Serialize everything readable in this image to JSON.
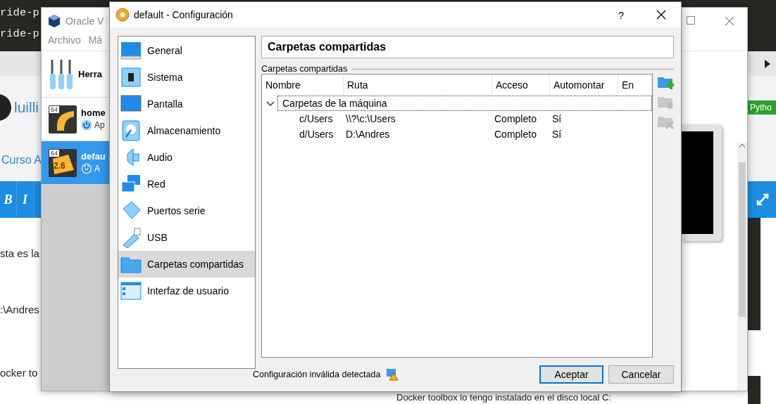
{
  "background_page": {
    "code_lines": [
      "ride-p",
      "ride-p"
    ],
    "user_name": "luilli",
    "course_link": "Curso A",
    "editor_toolbar": [
      {
        "label": "B"
      },
      {
        "label": "I"
      }
    ],
    "body_lines": [
      "sta es la",
      ":\\Andres",
      "ocker to"
    ],
    "tag": "Pytho",
    "footer_text": "Docker toolbox lo tengo instalado en el disco local C:"
  },
  "manager_window": {
    "title": "Oracle V",
    "menu": [
      "Archivo",
      "Má"
    ],
    "machines": [
      {
        "kind": "tools",
        "name": "Herra",
        "selected": false
      },
      {
        "kind": "vm",
        "name": "home",
        "arch": "64",
        "state": "Ap",
        "selected": false
      },
      {
        "kind": "vm",
        "name": "defau",
        "arch": "64",
        "badge": "2.6",
        "state": "A",
        "selected": true
      }
    ]
  },
  "dialog": {
    "title": "default - Configuración",
    "help": "?",
    "sections": [
      {
        "kind": "general",
        "label": "General",
        "selected": false
      },
      {
        "kind": "system",
        "label": "Sistema",
        "selected": false
      },
      {
        "kind": "display",
        "label": "Pantalla",
        "selected": false
      },
      {
        "kind": "storage",
        "label": "Almacenamiento",
        "selected": false
      },
      {
        "kind": "audio",
        "label": "Audio",
        "selected": false
      },
      {
        "kind": "network",
        "label": "Red",
        "selected": false
      },
      {
        "kind": "serial",
        "label": "Puertos serie",
        "selected": false
      },
      {
        "kind": "usb",
        "label": "USB",
        "selected": false
      },
      {
        "kind": "shared",
        "label": "Carpetas compartidas",
        "selected": true
      },
      {
        "kind": "ui",
        "label": "Interfaz de usuario",
        "selected": false
      }
    ],
    "page_title": "Carpetas compartidas",
    "group_label": "Carpetas compartidas",
    "table": {
      "columns": [
        "Nombre",
        "Ruta",
        "Acceso",
        "Automontar",
        "En"
      ],
      "groups": [
        {
          "label": "Carpetas de la máquina",
          "expanded": true,
          "rows": [
            {
              "name": "c/Users",
              "path": "\\\\?\\c:\\Users",
              "access": "Completo",
              "automount": "Sí"
            },
            {
              "name": "d/Users",
              "path": "D:\\Andres",
              "access": "Completo",
              "automount": "Sí"
            }
          ]
        }
      ]
    },
    "tool_buttons": [
      {
        "kind": "add",
        "disabled": false
      },
      {
        "kind": "edit",
        "disabled": true
      },
      {
        "kind": "remove",
        "disabled": true
      }
    ],
    "status": "Configuración inválida detectada",
    "buttons": [
      {
        "label": "Aceptar",
        "default": true
      },
      {
        "label": "Cancelar",
        "default": false
      }
    ]
  }
}
